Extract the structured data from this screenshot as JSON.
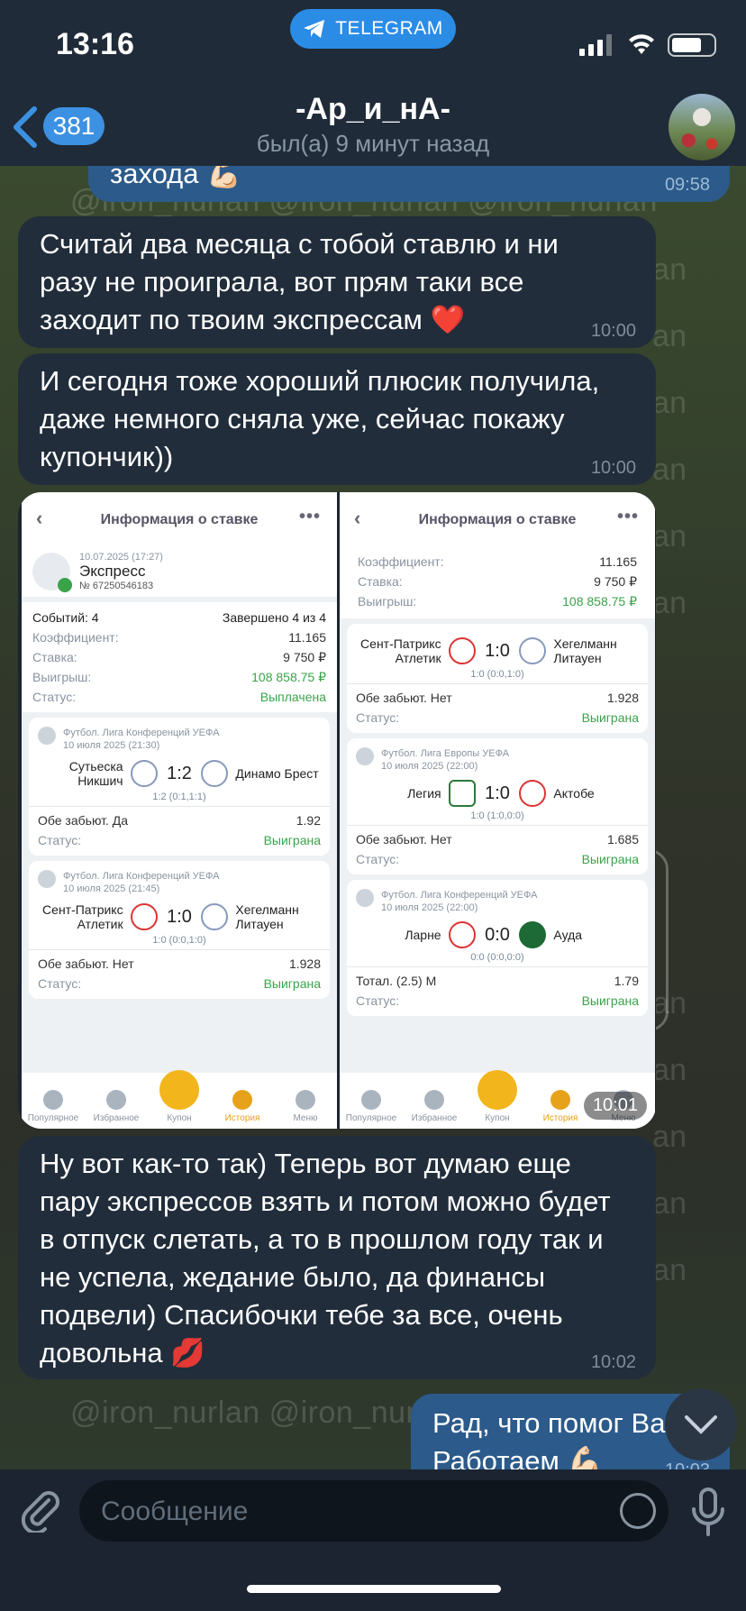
{
  "status_bar": {
    "time": "13:16",
    "app_pill": "TELEGRAM"
  },
  "header": {
    "back_count": "381",
    "contact_name": "-Ар_и_нА-",
    "last_seen": "был(а) 9 минут назад"
  },
  "watermark": {
    "text": "@iron_nurlan @iron_nurlan @iron_nurlan",
    "short": "an"
  },
  "messages": [
    {
      "id": "out-top",
      "text": "захода 💪🏻",
      "time": "09:58"
    },
    {
      "id": "in-1",
      "text": "Считай два месяца с тобой ставлю и ни разу не проиграла, вот прям таки все заходит по твоим экспрессам ❤️",
      "time": "10:00"
    },
    {
      "id": "in-2",
      "text": "И сегодня тоже хороший плюсик получила, даже немного сняла уже, сейчас покажу купончик))",
      "time": "10:00"
    },
    {
      "id": "in-photo",
      "time": "10:01"
    },
    {
      "id": "in-3",
      "text": "Ну вот как-то так) Теперь вот думаю еще пару экспрессов взять и потом можно будет в отпуск слетать, а то в прошлом году так и не успела, жедание было, да финансы подвели) Спасибочки тебе за все, очень довольна 💋",
      "time": "10:02"
    },
    {
      "id": "out-bottom",
      "line1": "Рад, что помог Ва",
      "line2": "Работаем 💪🏻",
      "time": "10:03"
    }
  ],
  "screenshot_left": {
    "header": "Информация о ставке",
    "date": "10.07.2025 (17:27)",
    "type": "Экспресс",
    "number": "№ 67250546183",
    "events_label": "Событий: 4",
    "completed": "Завершено 4 из 4",
    "rows": [
      {
        "k": "Коэффициент:",
        "v": "11.165"
      },
      {
        "k": "Ставка:",
        "v": "9 750 ₽"
      },
      {
        "k": "Выигрыш:",
        "v": "108 858.75 ₽"
      },
      {
        "k": "Статус:",
        "v": "Выплачена"
      }
    ],
    "matches": [
      {
        "league": "Футбол. Лига Конференций УЕФА",
        "date": "10 июля 2025 (21:30)",
        "home": "Сутьеска Никшич",
        "score": "1:2",
        "away": "Динамо Брест",
        "halves": "1:2 (0:1,1:1)",
        "bet": "Обе забьют. Да",
        "odds": "1.92",
        "status_label": "Статус:",
        "status": "Выиграна"
      },
      {
        "league": "Футбол. Лига Конференций УЕФА",
        "date": "10 июля 2025 (21:45)",
        "home": "Сент-Патрикс Атлетик",
        "score": "1:0",
        "away": "Хегелманн Литауен",
        "halves": "1:0 (0:0,1:0)",
        "bet": "Обе забьют. Нет",
        "odds": "1.928",
        "status_label": "Статус:",
        "status": "Выиграна"
      }
    ]
  },
  "screenshot_right": {
    "header": "Информация о ставке",
    "rows": [
      {
        "k": "Коэффициент:",
        "v": "11.165"
      },
      {
        "k": "Ставка:",
        "v": "9 750 ₽"
      },
      {
        "k": "Выигрыш:",
        "v": "108 858.75 ₽"
      }
    ],
    "matches": [
      {
        "league": "",
        "date": "",
        "home": "Сент-Патрикс Атлетик",
        "score": "1:0",
        "away": "Хегелманн Литауен",
        "halves": "1:0 (0:0,1:0)",
        "bet": "Обе забьют. Нет",
        "odds": "1.928",
        "status_label": "Статус:",
        "status": "Выиграна"
      },
      {
        "league": "Футбол. Лига Европы УЕФА",
        "date": "10 июля 2025 (22:00)",
        "home": "Легия",
        "score": "1:0",
        "away": "Актобе",
        "halves": "1:0 (1:0,0:0)",
        "bet": "Обе забьют. Нет",
        "odds": "1.685",
        "status_label": "Статус:",
        "status": "Выиграна"
      },
      {
        "league": "Футбол. Лига Конференций УЕФА",
        "date": "10 июля 2025 (22:00)",
        "home": "Ларне",
        "score": "0:0",
        "away": "Ауда",
        "halves": "0:0 (0:0,0:0)",
        "bet": "Тотал. (2.5) М",
        "odds": "1.79",
        "status_label": "Статус:",
        "status": "Выиграна"
      }
    ]
  },
  "app_tabs": [
    "Популярное",
    "Избранное",
    "Купон",
    "История",
    "Меню"
  ],
  "input": {
    "placeholder": "Сообщение"
  },
  "colors": {
    "accent": "#3d91e2",
    "bubble_in": "#212d3b",
    "bubble_out": "#2c5a8a",
    "won": "#3aa34a",
    "tab_active": "#e6a21a"
  }
}
